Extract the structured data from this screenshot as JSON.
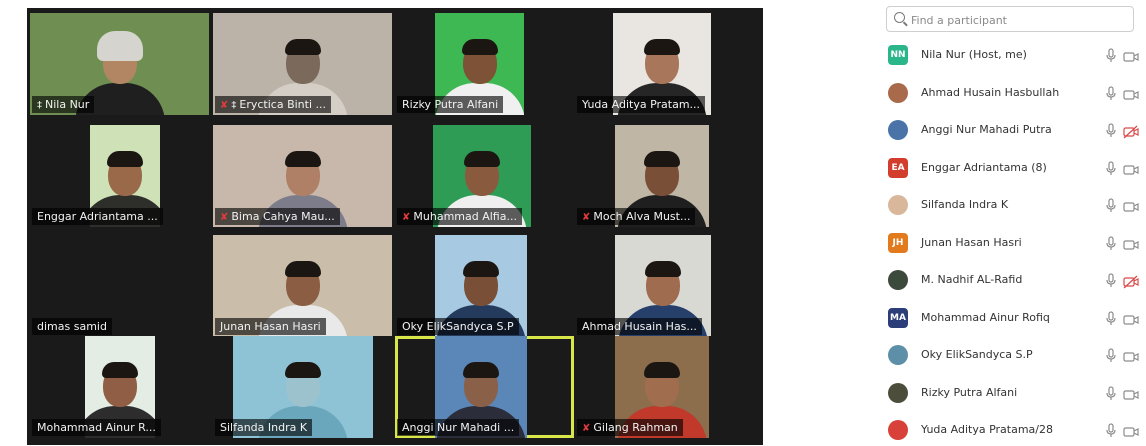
{
  "gallery": {
    "tiles": [
      {
        "name": "Nila Nur",
        "pinned": true,
        "muted": false
      },
      {
        "name": "Eryctica  Binti ...",
        "pinned": true,
        "muted": true
      },
      {
        "name": "Rizky Putra Alfani",
        "pinned": false,
        "muted": false
      },
      {
        "name": "Yuda Aditya Pratam...",
        "pinned": false,
        "muted": false
      },
      {
        "name": "Enggar Adriantama ...",
        "pinned": false,
        "muted": false
      },
      {
        "name": "Bima Cahya Mau...",
        "pinned": false,
        "muted": true
      },
      {
        "name": "Muhammad Alfia...",
        "pinned": false,
        "muted": true
      },
      {
        "name": "Moch Alva Must...",
        "pinned": false,
        "muted": true
      },
      {
        "name": "dimas samid",
        "pinned": false,
        "muted": false
      },
      {
        "name": "Junan Hasan Hasri",
        "pinned": false,
        "muted": false
      },
      {
        "name": "Oky ElikSandyca S.P",
        "pinned": false,
        "muted": false
      },
      {
        "name": "Ahmad Husain Has...",
        "pinned": false,
        "muted": false
      },
      {
        "name": "Mohammad Ainur R...",
        "pinned": false,
        "muted": false
      },
      {
        "name": "Silfanda Indra K",
        "pinned": false,
        "muted": false
      },
      {
        "name": "Anggi Nur Mahadi ...",
        "pinned": false,
        "muted": false,
        "speaking": true
      },
      {
        "name": "Gilang Rahman",
        "pinned": false,
        "muted": true
      }
    ],
    "speaker_highlight_color": "#d9e64a",
    "muted_icon_color": "#e33b3b"
  },
  "participants_panel": {
    "search_placeholder": "Find a participant",
    "participants": [
      {
        "name": "Nila Nur (Host, me)",
        "avatar_initials": "NN",
        "avatar_color": "#2bb58a",
        "avatar_type": "initials",
        "mic": "on",
        "video": "off"
      },
      {
        "name": "Ahmad Husain Hasbullah",
        "avatar_initials": "",
        "avatar_color": "#a86a4a",
        "avatar_type": "photo",
        "mic": "on",
        "video": "off"
      },
      {
        "name": "Anggi Nur Mahadi Putra",
        "avatar_initials": "",
        "avatar_color": "#4a74a8",
        "avatar_type": "photo",
        "mic": "on",
        "video": "blocked"
      },
      {
        "name": "Enggar Adriantama (8)",
        "avatar_initials": "EA",
        "avatar_color": "#d23d2d",
        "avatar_type": "initials",
        "mic": "on",
        "video": "off"
      },
      {
        "name": "Silfanda Indra K",
        "avatar_initials": "",
        "avatar_color": "#d9b79a",
        "avatar_type": "photo",
        "mic": "on",
        "video": "off"
      },
      {
        "name": "Junan Hasan Hasri",
        "avatar_initials": "JH",
        "avatar_color": "#e27a1e",
        "avatar_type": "initials",
        "mic": "on",
        "video": "off"
      },
      {
        "name": "M. Nadhif AL-Rafid",
        "avatar_initials": "",
        "avatar_color": "#3b4a3a",
        "avatar_type": "photo",
        "mic": "on",
        "video": "blocked"
      },
      {
        "name": "Mohammad Ainur Rofiq",
        "avatar_initials": "MA",
        "avatar_color": "#2c3e7a",
        "avatar_type": "initials",
        "mic": "on",
        "video": "off"
      },
      {
        "name": "Oky ElikSandyca S.P",
        "avatar_initials": "",
        "avatar_color": "#5e8fa8",
        "avatar_type": "photo",
        "mic": "on",
        "video": "off"
      },
      {
        "name": "Rizky Putra Alfani",
        "avatar_initials": "",
        "avatar_color": "#4d4d3b",
        "avatar_type": "photo",
        "mic": "on",
        "video": "off"
      },
      {
        "name": "Yuda Aditya Pratama/28",
        "avatar_initials": "",
        "avatar_color": "#d8403a",
        "avatar_type": "photo",
        "mic": "on",
        "video": "off"
      }
    ]
  }
}
